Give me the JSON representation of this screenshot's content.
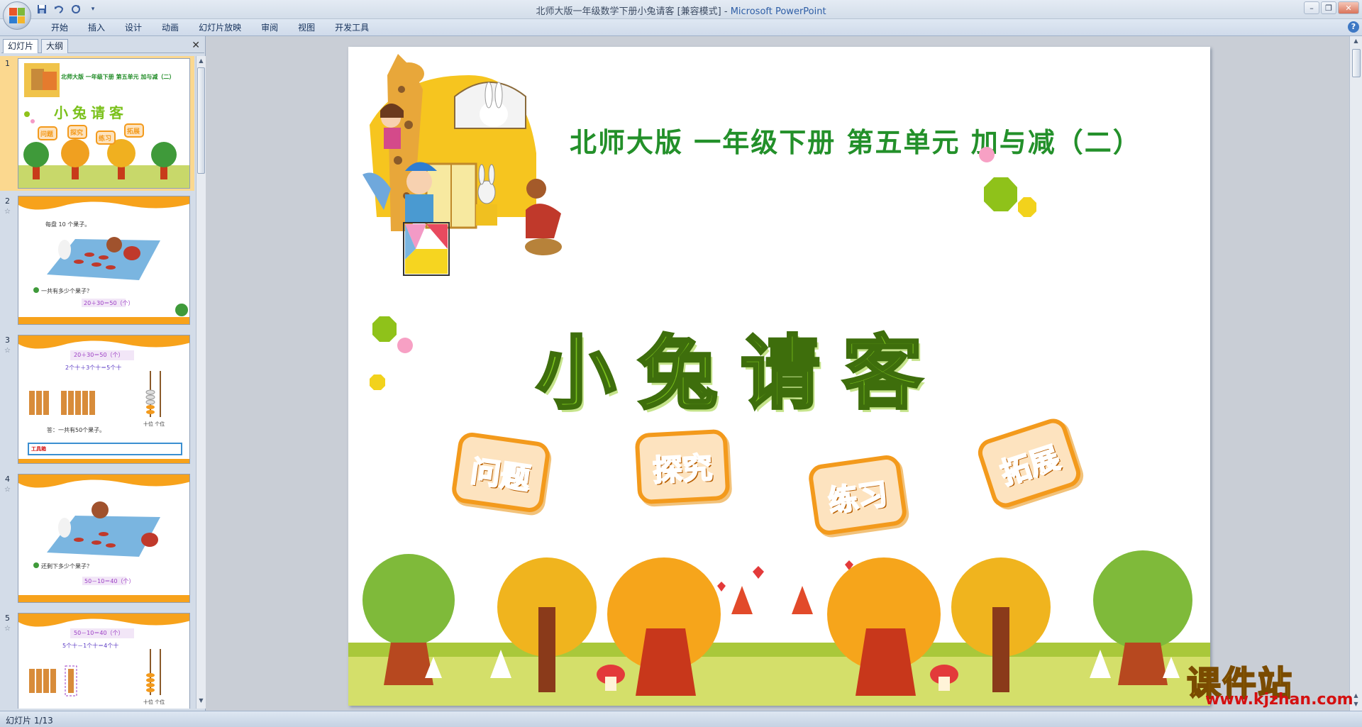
{
  "window": {
    "title_doc": "北师大版一年级数学下册小兔请客 [兼容模式]",
    "title_sep": " - ",
    "title_app": "Microsoft PowerPoint"
  },
  "ribbon": {
    "tabs": [
      "开始",
      "插入",
      "设计",
      "动画",
      "幻灯片放映",
      "审阅",
      "视图",
      "开发工具"
    ]
  },
  "panel": {
    "tabs": [
      "幻灯片",
      "大纲"
    ],
    "slides": [
      {
        "num": "1",
        "subtitle": "北师大版  一年级下册  第五单元  加与减（二）",
        "title": "小兔请客",
        "badges": [
          "问题",
          "探究",
          "练习",
          "拓展"
        ]
      },
      {
        "num": "2",
        "caption": "每盘 10 个果子。",
        "question": "一共有多少个果子？",
        "equation": "20＋30＝50（个）"
      },
      {
        "num": "3",
        "equation": "20＋30＝50（个）",
        "line": "2个十＋3个十＝5个十",
        "answer": "答：一共有50个果子。",
        "abacus": "十位 个位",
        "tools": "工具箱"
      },
      {
        "num": "4",
        "question": "还剩下多少个果子？",
        "equation": "50－10＝40（个）"
      },
      {
        "num": "5",
        "equation": "50－10＝40（个）",
        "line": "5个十－1个十＝4个十",
        "abacus": "十位 个位"
      }
    ]
  },
  "slide": {
    "subtitle": "北师大版  一年级下册  第五单元  加与减（二）",
    "title": "小兔请客",
    "badges": [
      "问题",
      "探究",
      "练习",
      "拓展"
    ]
  },
  "watermark": {
    "name": "课件站",
    "url": "www.kjzhan.com"
  },
  "status": {
    "text": "幻灯片 1/13"
  },
  "icons": {
    "office": "office-button-icon",
    "save": "save-icon",
    "undo": "undo-icon",
    "redo": "redo-icon",
    "help": "help-icon"
  },
  "colors": {
    "subtitle_green": "#23902a",
    "title_green": "#7bc11c",
    "badge_orange": "#f39a1c",
    "selected_thumb": "#fbd88f"
  }
}
